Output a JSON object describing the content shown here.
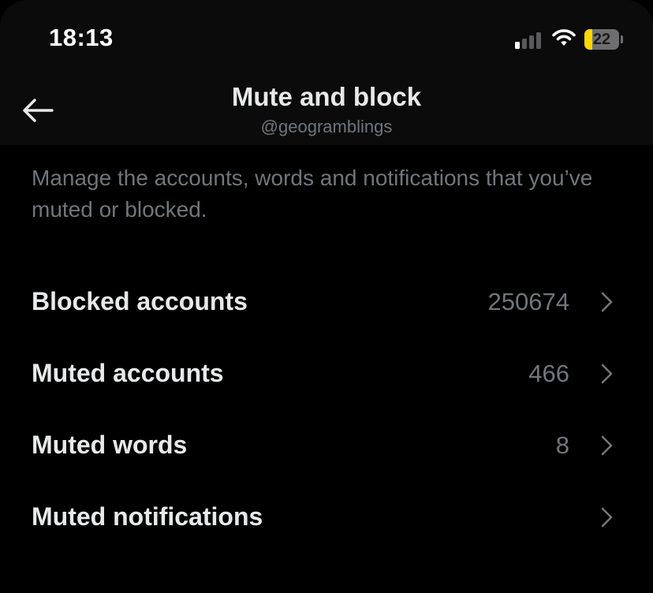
{
  "status_bar": {
    "time": "18:13",
    "battery_level": "22",
    "battery_fraction": 0.22,
    "signal_bars_active": 1,
    "signal_bars_total": 4,
    "signal_icon": "cellular-signal-icon",
    "wifi_icon": "wifi-icon",
    "battery_icon": "battery-icon"
  },
  "header": {
    "title": "Mute and block",
    "subtitle": "@geogramblings",
    "back_icon": "arrow-left-icon"
  },
  "description": "Manage the accounts, words and notifications that you’ve muted or blocked.",
  "settings": {
    "items": [
      {
        "label": "Blocked accounts",
        "count": "250674"
      },
      {
        "label": "Muted accounts",
        "count": "466"
      },
      {
        "label": "Muted words",
        "count": "8"
      },
      {
        "label": "Muted notifications",
        "count": ""
      }
    ],
    "chevron_icon": "chevron-right-icon"
  },
  "colors": {
    "background": "#000000",
    "header_background": "#0b0b0b",
    "primary_text": "#e7e9ea",
    "secondary_text": "#71767b",
    "battery_accent": "#ffd60a"
  }
}
